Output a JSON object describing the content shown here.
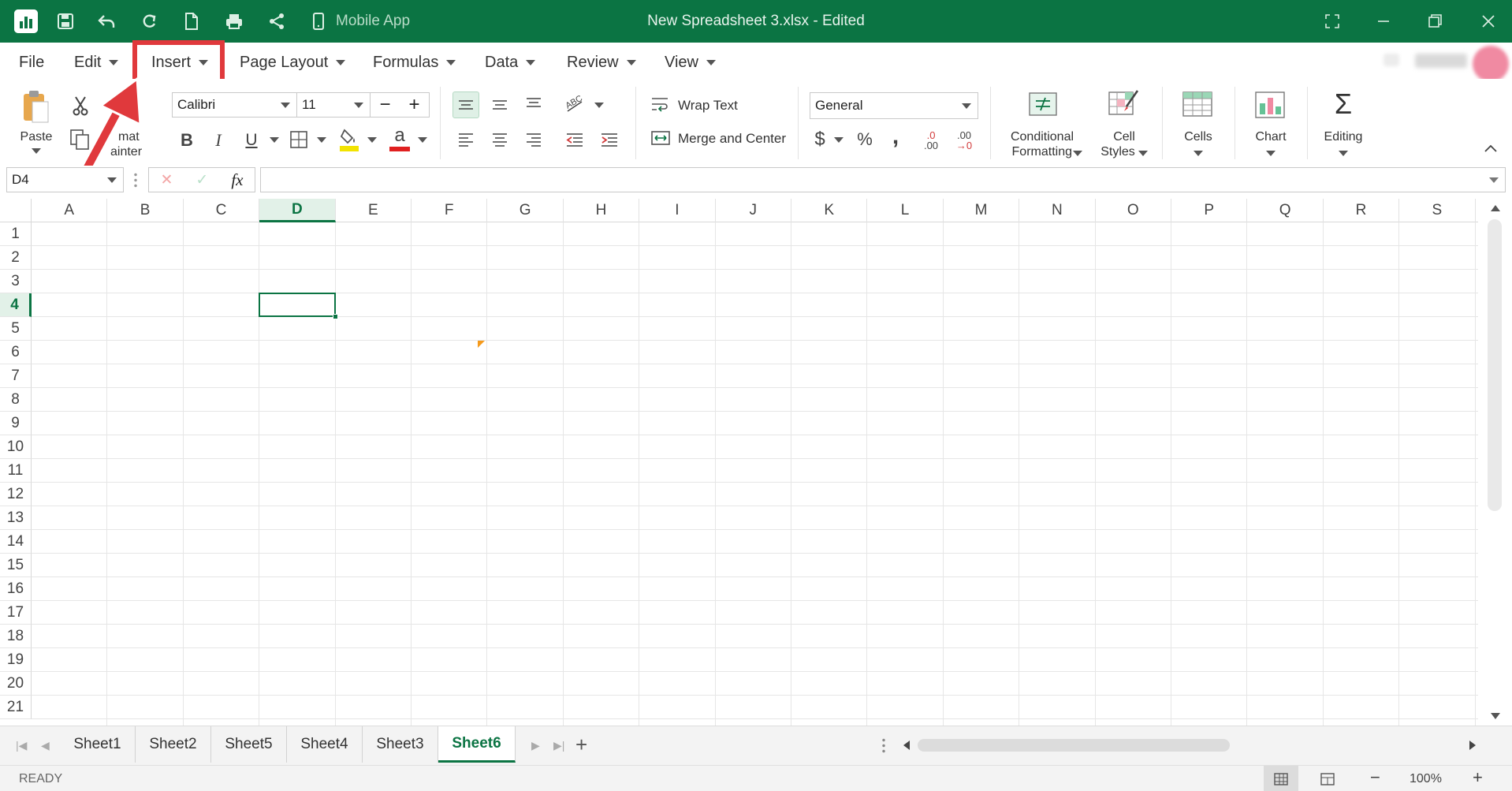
{
  "titlebar": {
    "title": "New Spreadsheet 3.xlsx - Edited",
    "mobile_app_label": "Mobile App",
    "accent_color": "#0b7443"
  },
  "menu": {
    "items": [
      "File",
      "Edit",
      "Insert",
      "Page Layout",
      "Formulas",
      "Data",
      "Review",
      "View"
    ],
    "highlighted": "Insert"
  },
  "toolbar": {
    "paste_label": "Paste",
    "format_painter_label_1": "mat",
    "format_painter_label_2": "ainter",
    "font_name": "Calibri",
    "font_size": "11",
    "bold_label": "B",
    "italic_label": "I",
    "underline_label": "U",
    "font_color_glyph": "a",
    "wrap_text_label": "Wrap Text",
    "merge_center_label": "Merge and Center",
    "number_format": "General",
    "currency_glyph": "$",
    "percent_glyph": "%",
    "comma_glyph": ",",
    "inc_decimal_top": ".0",
    "inc_decimal_bottom": ".00",
    "dec_decimal_top": ".00",
    "dec_decimal_bottom": "→0",
    "conditional_formatting_label_1": "Conditional",
    "conditional_formatting_label_2": "Formatting",
    "cell_styles_label_1": "Cell",
    "cell_styles_label_2": "Styles",
    "cells_label": "Cells",
    "chart_label": "Chart",
    "editing_label": "Editing",
    "sigma_glyph": "Σ"
  },
  "formula_bar": {
    "name_box": "D4",
    "fx_label": "fx",
    "cancel_glyph": "✕",
    "confirm_glyph": "✓",
    "formula_value": ""
  },
  "grid": {
    "columns": [
      "A",
      "B",
      "C",
      "D",
      "E",
      "F",
      "G",
      "H",
      "I",
      "J",
      "K",
      "L",
      "M",
      "N",
      "O",
      "P",
      "Q",
      "R",
      "S"
    ],
    "rows": [
      "1",
      "2",
      "3",
      "4",
      "5",
      "6",
      "7",
      "8",
      "9",
      "10",
      "11",
      "12",
      "13",
      "14",
      "15",
      "16",
      "17",
      "18",
      "19",
      "20",
      "21"
    ],
    "selected_cell": "D4",
    "selected_column": "D",
    "selected_row": "4"
  },
  "sheets": {
    "tabs": [
      "Sheet1",
      "Sheet2",
      "Sheet5",
      "Sheet4",
      "Sheet3",
      "Sheet6"
    ],
    "active": "Sheet6"
  },
  "status": {
    "ready_text": "READY",
    "zoom": "100%",
    "zoom_out_glyph": "−",
    "zoom_in_glyph": "+"
  }
}
